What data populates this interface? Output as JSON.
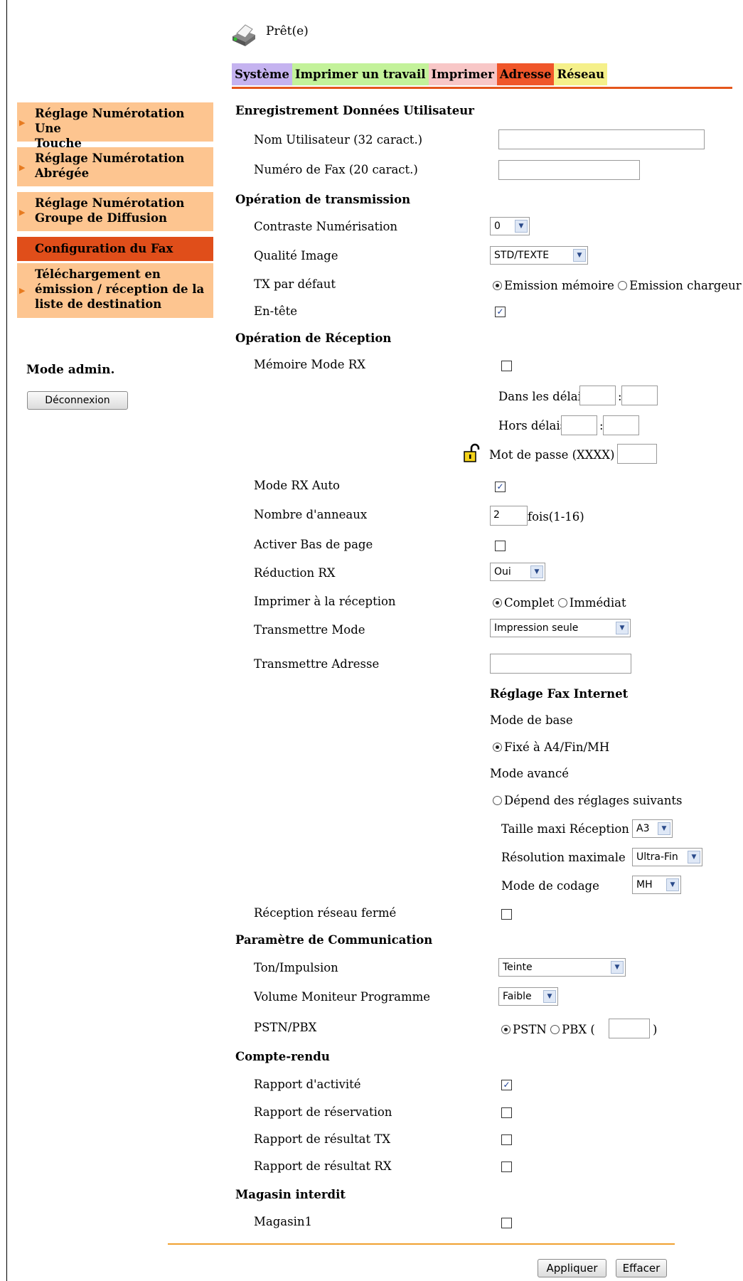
{
  "status": {
    "text": "Prêt(e)"
  },
  "tabs": [
    {
      "label": "Système",
      "color": "#c5b3f0"
    },
    {
      "label": "Imprimer un travail",
      "color": "#c3f29a"
    },
    {
      "label": "Imprimer",
      "color": "#f8c7c7"
    },
    {
      "label": "Adresse",
      "color": "#f0562a"
    },
    {
      "label": "Réseau",
      "color": "#f5f08a"
    }
  ],
  "sidebar": {
    "items": [
      {
        "lines": [
          "Réglage Numérotation Une",
          "Touche"
        ]
      },
      {
        "lines": [
          "Réglage Numérotation",
          "Abrégée"
        ]
      },
      {
        "lines": [
          "Réglage Numérotation",
          "Groupe de Diffusion"
        ]
      },
      {
        "lines": [
          "Configuration du Fax"
        ]
      },
      {
        "lines": [
          "Téléchargement en",
          "émission / réception de la",
          "liste de destination"
        ]
      }
    ],
    "admin_label": "Mode admin.",
    "logout_button": "Déconnexion"
  },
  "user": {
    "title": "Enregistrement Données Utilisateur",
    "name_label": "Nom Utilisateur (32 caract.)",
    "name_value": "",
    "fax_label": "Numéro de Fax (20 caract.)",
    "fax_value": ""
  },
  "tx": {
    "title": "Opération de transmission",
    "contrast_label": "Contraste Numérisation",
    "contrast_value": "0",
    "quality_label": "Qualité Image",
    "quality_value": "STD/TEXTE",
    "default_label": "TX par défaut",
    "default_opt1": "Emission mémoire",
    "default_opt2": "Emission chargeur",
    "header_label": "En-tête",
    "header_checked": true
  },
  "rx": {
    "title": "Opération de Réception",
    "memory_label": "Mémoire Mode RX",
    "memory_checked": false,
    "within_label": "Dans les délais",
    "outside_label": "Hors délais",
    "password_label": "Mot de passe (XXXX)",
    "auto_label": "Mode RX Auto",
    "auto_checked": true,
    "rings_label": "Nombre d'anneaux",
    "rings_value": "2",
    "rings_unit": "fois(1-16)",
    "footer_label": "Activer Bas de page",
    "footer_checked": false,
    "reduction_label": "Réduction RX",
    "reduction_value": "Oui",
    "print_label": "Imprimer à la réception",
    "print_opt1": "Complet",
    "print_opt2": "Immédiat",
    "forward_mode_label": "Transmettre Mode",
    "forward_mode_value": "Impression seule",
    "forward_addr_label": "Transmettre Adresse",
    "forward_addr_value": ""
  },
  "ifax": {
    "title": "Réglage Fax Internet",
    "basic_label": "Mode de base",
    "basic_option": "Fixé à A4/Fin/MH",
    "advanced_label": "Mode avancé",
    "advanced_option": "Dépend des réglages suivants",
    "size_label": "Taille maxi Réception",
    "size_value": "A3",
    "resolution_label": "Résolution maximale",
    "resolution_value": "Ultra-Fin",
    "coding_label": "Mode de codage",
    "coding_value": "MH"
  },
  "closed_network": {
    "label": "Réception réseau fermé",
    "checked": false
  },
  "comm": {
    "title": "Paramètre de Communication",
    "tone_label": "Ton/Impulsion",
    "tone_value": "Teinte",
    "volume_label": "Volume Moniteur Programme",
    "volume_value": "Faible",
    "pstn_label": "PSTN/PBX",
    "pstn_opt1": "PSTN",
    "pstn_opt2": "PBX (",
    "pstn_close": ")"
  },
  "report": {
    "title": "Compte-rendu",
    "activity_label": "Rapport d'activité",
    "activity_checked": true,
    "reservation_label": "Rapport de réservation",
    "tx_label": "Rapport de résultat TX",
    "rx_label": "Rapport de résultat RX"
  },
  "tray": {
    "title": "Magasin interdit",
    "tray1_label": "Magasin1"
  },
  "actions": {
    "apply": "Appliquer",
    "clear": "Effacer"
  },
  "icons": {
    "printer": "printer-status-icon",
    "lock": "padlock-icon",
    "menu_arrow": "menu-arrow-icon",
    "dropdown": "dropdown-arrow-icon"
  }
}
